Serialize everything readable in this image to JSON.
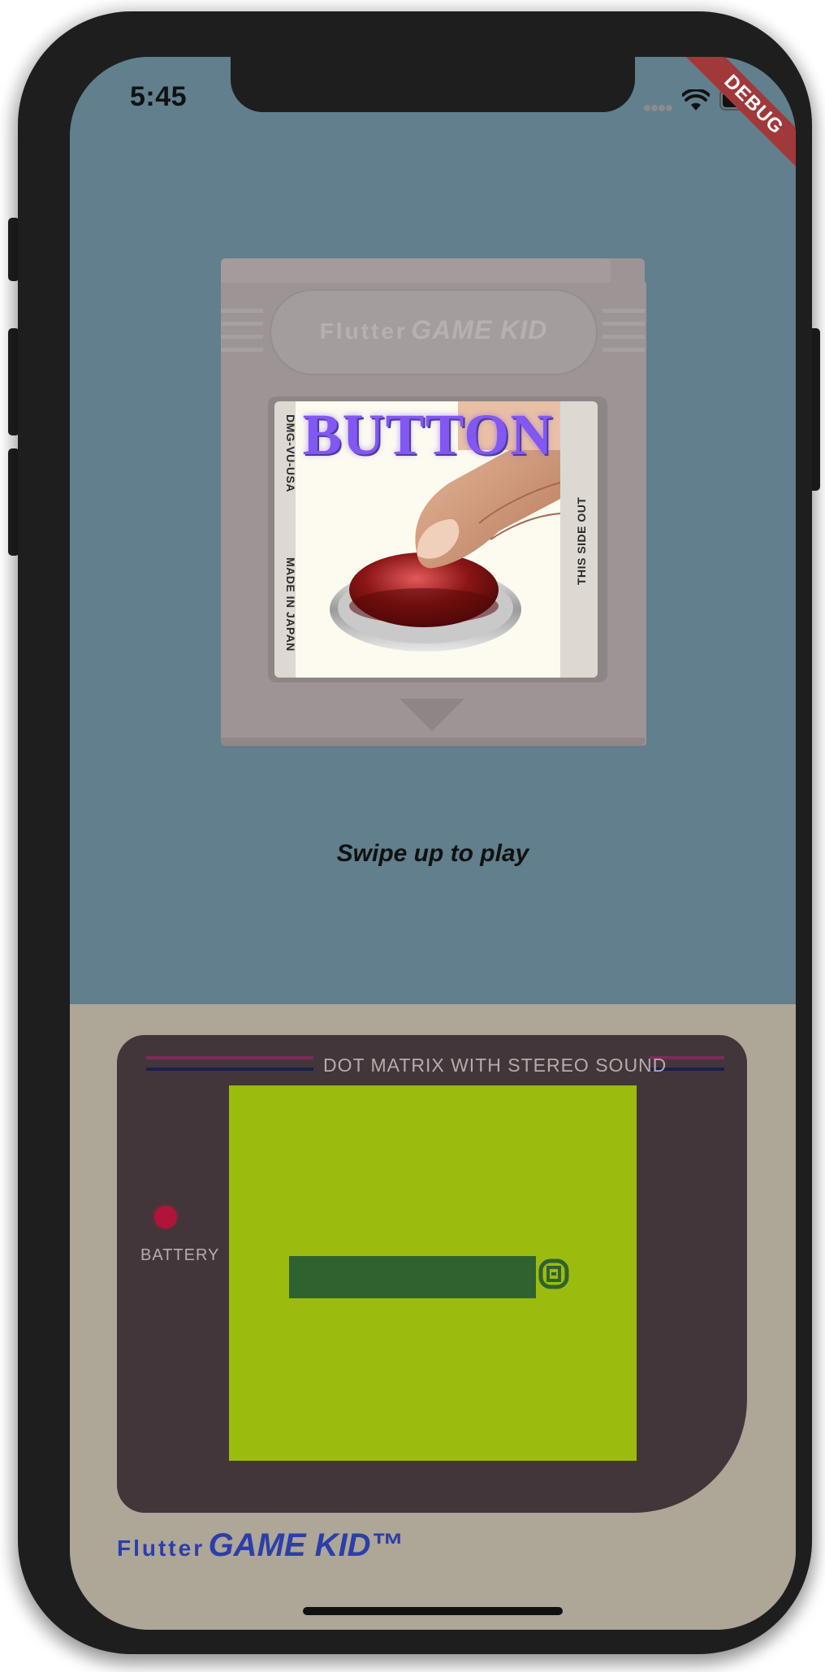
{
  "status_bar": {
    "time": "5:45",
    "icons": [
      "signal-icon",
      "wifi-icon",
      "battery-icon"
    ]
  },
  "debug_banner": {
    "label": "DEBUG"
  },
  "cartridge": {
    "brand_primary": "Flutter",
    "brand_secondary": "GAME KID",
    "label_left_top": "DMG-VU-USA",
    "label_left_bottom": "MADE IN JAPAN",
    "label_right": "THIS SIDE OUT",
    "game_title": "BUTTON",
    "artwork": "finger-pressing-red-button"
  },
  "hint": {
    "text": "Swipe up to play"
  },
  "console": {
    "screen_caption": "DOT MATRIX WITH STEREO SOUND",
    "battery_label": "BATTERY",
    "brand_primary": "Flutter",
    "brand_secondary": "GAME KID™"
  },
  "colors": {
    "background_top": "#617f8d",
    "console_body": "#aea696",
    "bezel": "#42363a",
    "lcd": "#9bbc0f",
    "lcd_dark": "#306230",
    "brand_blue": "#2b3eaa",
    "battery_led": "#b0143a",
    "debug_banner": "#a1383a"
  }
}
